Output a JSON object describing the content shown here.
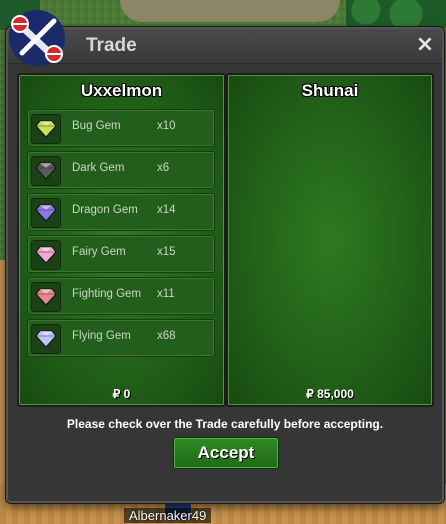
{
  "window": {
    "title": "Trade",
    "close_label": "×"
  },
  "left_panel": {
    "player": "Uxxelmon",
    "items": [
      {
        "name": "Bug Gem",
        "qty": "x10",
        "icon": "bug-gem-icon",
        "color": "#c8e05a"
      },
      {
        "name": "Dark Gem",
        "qty": "x6",
        "icon": "dark-gem-icon",
        "color": "#5a5a5a"
      },
      {
        "name": "Dragon Gem",
        "qty": "x14",
        "icon": "dragon-gem-icon",
        "color": "#8a7ae6"
      },
      {
        "name": "Fairy Gem",
        "qty": "x15",
        "icon": "fairy-gem-icon",
        "color": "#f0a8d4"
      },
      {
        "name": "Fighting Gem",
        "qty": "x11",
        "icon": "fighting-gem-icon",
        "color": "#e88a8a"
      },
      {
        "name": "Flying Gem",
        "qty": "x68",
        "icon": "flying-gem-icon",
        "color": "#b8c8f5"
      }
    ],
    "money": "₽ 0"
  },
  "right_panel": {
    "player": "Shunai",
    "items": [],
    "money": "₽ 85,000"
  },
  "notice": "Please check over the Trade carefully before accepting.",
  "accept_label": "Accept",
  "world": {
    "player_name": "Albernaker49"
  }
}
